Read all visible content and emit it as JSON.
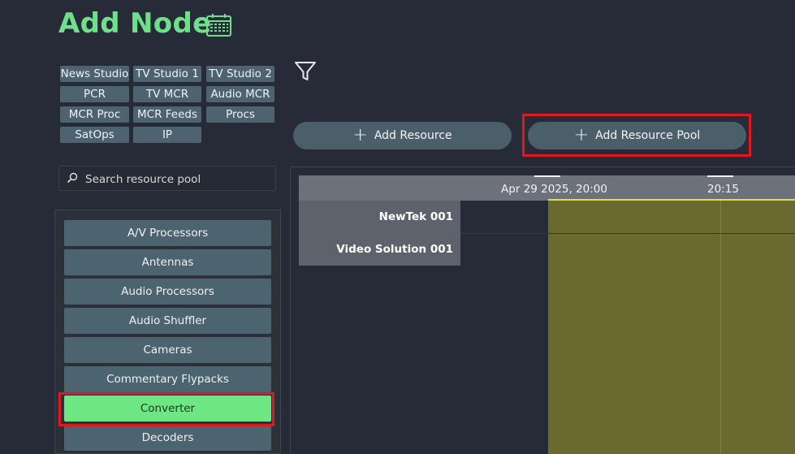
{
  "page": {
    "title": "Add Node"
  },
  "filters": {
    "chips": [
      "News Studio",
      "TV Studio 1",
      "TV Studio 2",
      "PCR",
      "TV MCR",
      "Audio MCR",
      "MCR Proc",
      "MCR Feeds",
      "Procs",
      "SatOps",
      "IP"
    ]
  },
  "actions": {
    "add_resource": "Add Resource",
    "add_resource_pool": "Add Resource Pool"
  },
  "search": {
    "placeholder": "Search resource pool"
  },
  "resource_pools": {
    "items": [
      "A/V Processors",
      "Antennas",
      "Audio Processors",
      "Audio Shuffler",
      "Cameras",
      "Commentary Flypacks",
      "Converter",
      "Decoders"
    ],
    "selected": "Converter"
  },
  "timeline": {
    "ticks": [
      "Apr 29 2025, 20:00",
      "20:15"
    ],
    "rows": [
      "NewTek 001",
      "Video Solution 001"
    ]
  },
  "colors": {
    "title": "#6fe08a",
    "chip": "#4d6470",
    "selected": "#6ce783",
    "highlight_box": "#e01822",
    "now_line": "#e2e23a"
  },
  "icons": [
    "calendar-icon",
    "filter-icon",
    "plus-icon",
    "search-icon"
  ]
}
